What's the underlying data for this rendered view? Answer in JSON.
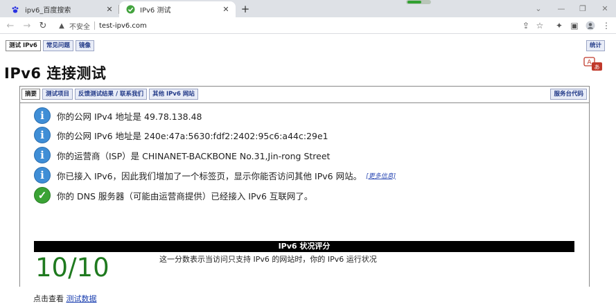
{
  "browser": {
    "tabs": [
      {
        "title": "ipv6_百度搜索",
        "active": false,
        "favicon": "baidu-paw-icon"
      },
      {
        "title": "IPv6 测试",
        "active": true,
        "favicon": "green-check-icon"
      }
    ],
    "not_secure_label": "不安全",
    "url": "test-ipv6.com"
  },
  "page": {
    "top_nav": [
      "测试 IPv6",
      "常见问题",
      "镜像"
    ],
    "stats_label": "统计",
    "heading": "IPv6 连接测试",
    "panel_tabs": [
      "摘要",
      "测试项目",
      "反馈测试结果 / 联系我们",
      "其他 IPv6 网站"
    ],
    "panel_right_tab": "服务台代码",
    "results": [
      {
        "icon": "info",
        "text": "你的公网 IPv4 地址是 49.78.138.48"
      },
      {
        "icon": "info",
        "text": "你的公网 IPv6 地址是 240e:47a:5630:fdf2:2402:95c6:a44c:29e1"
      },
      {
        "icon": "info",
        "text": "你的运营商（ISP）是 CHINANET-BACKBONE No.31,Jin-rong Street"
      },
      {
        "icon": "info",
        "text": "你已接入 IPv6，因此我们增加了一个标签页，显示你能否访问其他 IPv6 网站。",
        "link": "[更多信息]"
      },
      {
        "icon": "ok",
        "text": "你的 DNS 服务器（可能由运营商提供）已经接入 IPv6 互联网了。"
      }
    ],
    "score_title": "IPv6 状况评分",
    "score": "10/10",
    "score_desc": "这一分数表示当访问只支持 IPv6 的网站时，你的 IPv6 运行状况",
    "click_view_prefix": "点击查看",
    "click_view_link": "测试数据"
  },
  "colors": {
    "score_green": "#1f7a1f",
    "info_blue": "#3f8ed6",
    "ok_green": "#3aa335"
  }
}
